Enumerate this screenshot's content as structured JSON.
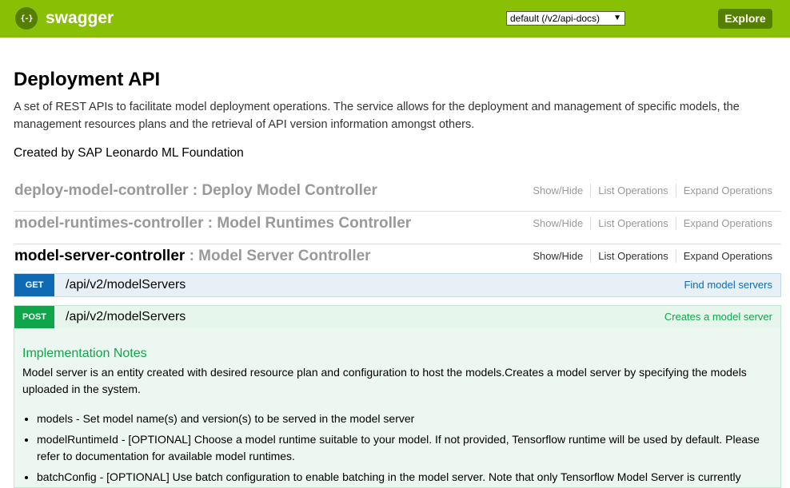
{
  "header": {
    "logo_glyph": "{-}",
    "logo_text": "swagger",
    "spec_selected": "default (/v2/api-docs)",
    "explore_label": "Explore",
    "colors": {
      "bar": "#89bf04",
      "dark": "#547f00"
    }
  },
  "info": {
    "title": "Deployment API",
    "description": "A set of REST APIs to facilitate model deployment operations. The service allows for the deployment and management of specific models, the management resources plans and the retrieval of API version information amongst others.",
    "created_by": "Created by SAP Leonardo ML Foundation"
  },
  "resources": [
    {
      "name": "deploy-model-controller",
      "desc": ": Deploy Model Controller"
    },
    {
      "name": "model-runtimes-controller",
      "desc": ": Model Runtimes Controller"
    },
    {
      "name": "model-server-controller",
      "desc": ": Model Server Controller"
    }
  ],
  "resource_links": {
    "show_hide": "Show/Hide",
    "list_ops": "List Operations",
    "expand_ops": "Expand Operations"
  },
  "operations": [
    {
      "method": "GET",
      "path": "/api/v2/modelServers",
      "summary": "Find model servers"
    },
    {
      "method": "POST",
      "path": "/api/v2/modelServers",
      "summary": "Creates a model server"
    }
  ],
  "implementation": {
    "title": "Implementation Notes",
    "text": "Model server is an entity created with desired resource plan and configuration to host the models.Creates a model server by specifying the models uploaded in the system.",
    "items": [
      "models - Set model name(s) and version(s) to be served in the model server",
      "modelRuntimeId - [OPTIONAL] Choose a model runtime suitable to your model. If not provided, Tensorflow runtime will be used by default. Please refer to documentation for available model runtimes.",
      "batchConfig - [OPTIONAL] Use batch configuration to enable batching in the model server. Note that only Tensorflow Model Server is currently"
    ]
  }
}
